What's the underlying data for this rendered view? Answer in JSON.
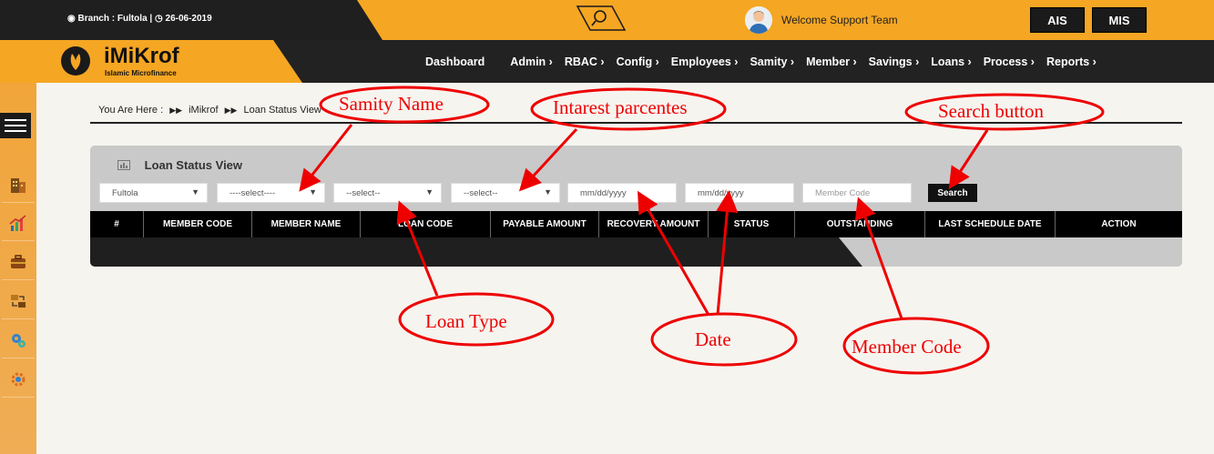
{
  "header": {
    "branch_label": "Branch : Fultola |",
    "date": "26-06-2019",
    "welcome_text": "Welcome Support Team",
    "system_buttons": {
      "ais": "AIS",
      "mis": "MIS"
    },
    "accent_color": "#f5a623"
  },
  "brand": {
    "name": "iMiKrof",
    "subtitle": "Islamic Microfinance"
  },
  "nav": {
    "items": [
      {
        "label": "Dashboard"
      },
      {
        "label": "Admin ›"
      },
      {
        "label": "RBAC ›"
      },
      {
        "label": "Config ›"
      },
      {
        "label": "Employees ›"
      },
      {
        "label": "Samity ›"
      },
      {
        "label": "Member ›"
      },
      {
        "label": "Savings ›"
      },
      {
        "label": "Loans ›"
      },
      {
        "label": "Process ›"
      },
      {
        "label": "Reports ›"
      }
    ]
  },
  "sidebar": {
    "icons": [
      "building-icon",
      "chart-icon",
      "briefcase-icon",
      "transfer-icon",
      "gears-icon",
      "settings-icon"
    ]
  },
  "breadcrumb": {
    "prefix": "You Are Here  :",
    "item1": "iMikrof",
    "item2": "Loan Status View"
  },
  "panel": {
    "title": "Loan Status View",
    "filters": {
      "branch": "Fultola",
      "samity": "----select----",
      "loan_type": "--select--",
      "interest": "--select--",
      "date_from_placeholder": "mm/dd/yyyy",
      "date_to_placeholder": "mm/dd/yyyy",
      "member_code_placeholder": "Member Code"
    },
    "search_label": "Search",
    "columns": [
      "#",
      "MEMBER CODE",
      "MEMBER NAME",
      "LOAN CODE",
      "PAYABLE AMOUNT",
      "RECOVERY AMOUNT",
      "STATUS",
      "OUTSTANDING",
      "LAST SCHEDULE DATE",
      "ACTION"
    ]
  },
  "annotations": {
    "samity_name": "Samity Name",
    "interest": "Intarest parcentes",
    "search_button": "Search button",
    "loan_type": "Loan Type",
    "date": "Date",
    "member_code": "Member Code",
    "color": "#e00000"
  }
}
